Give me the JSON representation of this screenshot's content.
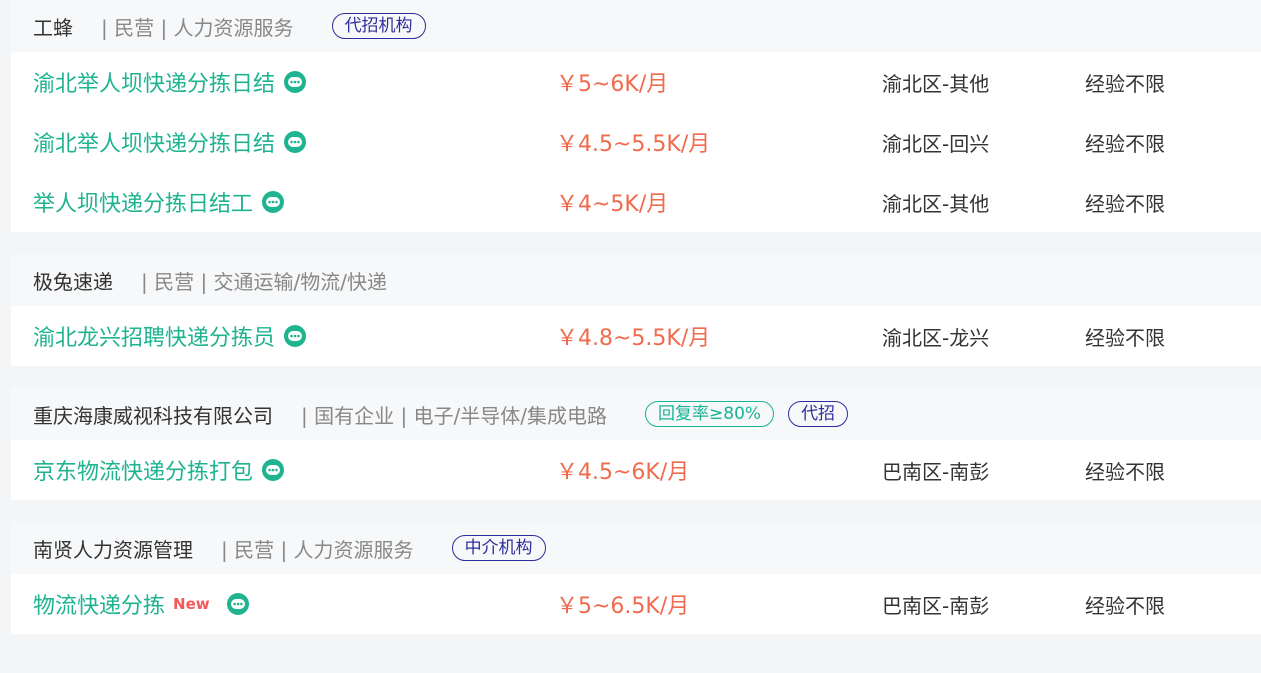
{
  "companies": [
    {
      "name": "工蜂",
      "meta": "| 民营 | 人力资源服务",
      "tags": [
        {
          "label": "代招机构",
          "style": "blue"
        }
      ],
      "jobs": [
        {
          "title": "渝北举人坝快递分拣日结",
          "salary": "￥5~6K/月",
          "location": "渝北区-其他",
          "experience": "经验不限",
          "chat_icon": "chat-bubble-icon"
        },
        {
          "title": "渝北举人坝快递分拣日结",
          "salary": "￥4.5~5.5K/月",
          "location": "渝北区-回兴",
          "experience": "经验不限",
          "chat_icon": "chat-bubble-icon"
        },
        {
          "title": "举人坝快递分拣日结工",
          "salary": "￥4~5K/月",
          "location": "渝北区-其他",
          "experience": "经验不限",
          "chat_icon": "chat-bubble-icon"
        }
      ]
    },
    {
      "name": "极兔速递",
      "meta": "| 民营 | 交通运输/物流/快递",
      "tags": [],
      "jobs": [
        {
          "title": "渝北龙兴招聘快递分拣员",
          "salary": "￥4.8~5.5K/月",
          "location": "渝北区-龙兴",
          "experience": "经验不限",
          "chat_icon": "chat-bubble-icon"
        }
      ]
    },
    {
      "name": "重庆海康威视科技有限公司",
      "meta": "| 国有企业 | 电子/半导体/集成电路",
      "tags": [
        {
          "label": "回复率≥80%",
          "style": "green"
        },
        {
          "label": "代招",
          "style": "blue"
        }
      ],
      "jobs": [
        {
          "title": "京东物流快递分拣打包",
          "salary": "￥4.5~6K/月",
          "location": "巴南区-南彭",
          "experience": "经验不限",
          "chat_icon": "chat-bubble-icon"
        }
      ]
    },
    {
      "name": "南贤人力资源管理",
      "meta": "| 民营 | 人力资源服务",
      "tags": [
        {
          "label": "中介机构",
          "style": "blue"
        }
      ],
      "jobs": [
        {
          "title": "物流快递分拣",
          "new_badge": "New",
          "salary": "￥5~6.5K/月",
          "location": "巴南区-南彭",
          "experience": "经验不限",
          "chat_icon": "chat-bubble-icon"
        }
      ]
    }
  ],
  "colors": {
    "job_title": "#1fb38f",
    "salary": "#f06a4d",
    "tag_blue": "#2e2e9c",
    "tag_green": "#18b596",
    "new_badge": "#f25a5a",
    "chat_icon": "#1fb38f"
  }
}
